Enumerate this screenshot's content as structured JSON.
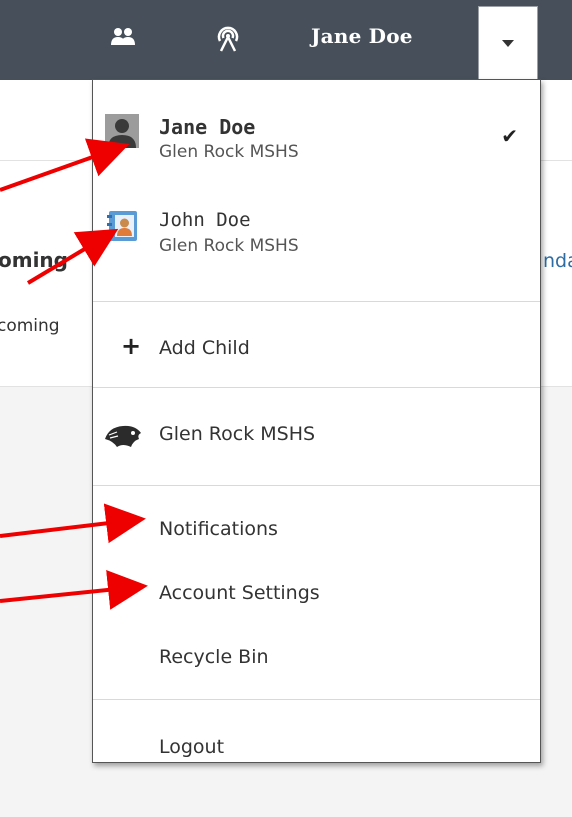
{
  "topbar": {
    "user_name": "Jane Doe",
    "icons": [
      "people-icon",
      "signal-icon",
      "chevron-down-icon"
    ],
    "background_color": "#47505a"
  },
  "background": {
    "heading_fragment": "oming",
    "text_fragment": "coming",
    "link_fragment": "nda"
  },
  "menu": {
    "accounts": [
      {
        "name": "Jane Doe",
        "school": "Glen Rock MSHS",
        "active": true,
        "icon": "user-silhouette-icon"
      },
      {
        "name": "John Doe",
        "school": "Glen Rock MSHS",
        "active": false,
        "icon": "student-contact-icon"
      }
    ],
    "add_child": "Add Child",
    "school": "Glen Rock MSHS",
    "notifications": "Notifications",
    "account_settings": "Account Settings",
    "recycle_bin": "Recycle Bin",
    "logout": "Logout"
  },
  "annotation": {
    "arrow_color": "#ee0000"
  }
}
